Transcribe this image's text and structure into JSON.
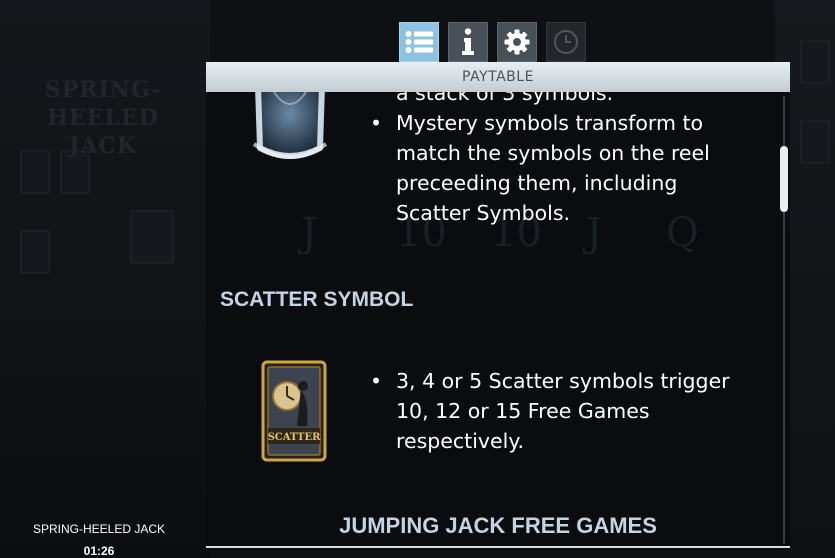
{
  "toolbar": {
    "buttons": [
      {
        "icon": "list-icon",
        "state": "active"
      },
      {
        "icon": "info-icon",
        "state": "normal"
      },
      {
        "icon": "gear-icon",
        "state": "normal"
      },
      {
        "icon": "clock-icon",
        "state": "disabled"
      }
    ]
  },
  "header": {
    "title": "PAYTABLE"
  },
  "paytable": {
    "mystery": {
      "partial_line": "a stack of 3 symbols.",
      "bullet": "Mystery symbols transform to match the symbols on the reel preceeding them, including Scatter Symbols."
    },
    "scatter": {
      "title": "SCATTER SYMBOL",
      "symbol_label": "SCATTER",
      "bullet": "3, 4 or 5 Scatter symbols trigger 10, 12 or 15 Free Games respectively."
    },
    "free_games": {
      "title": "JUMPING JACK FREE GAMES"
    }
  },
  "background": {
    "logo_text": "SPRING-HEELED JACK"
  },
  "footer": {
    "game_name": "SPRING-HEELED JACK",
    "clock": "01:26"
  },
  "colors": {
    "active_button": "#8fc1e0",
    "section_title": "#c5d3e2",
    "header_bg": "#dfe6ec"
  }
}
